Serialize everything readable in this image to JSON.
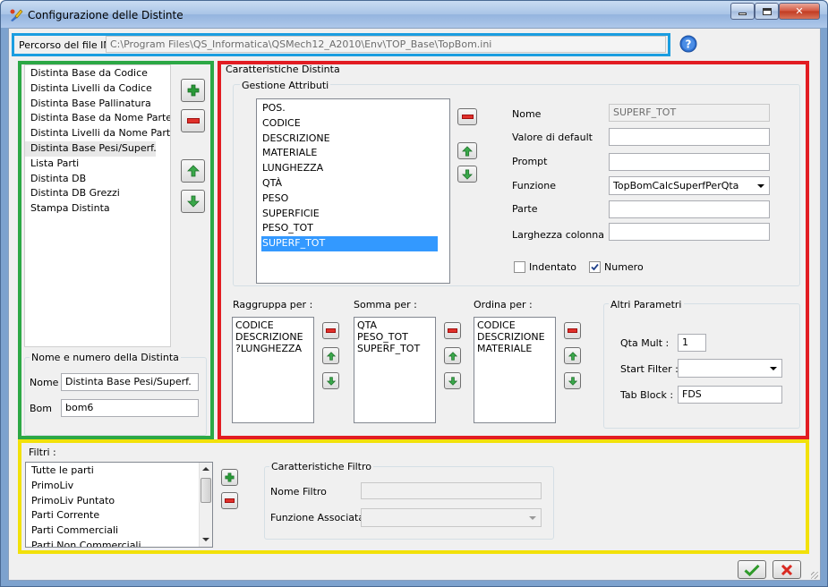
{
  "window": {
    "title": "Configurazione delle Distinte"
  },
  "ini": {
    "label": "Percorso del file INI",
    "path": "C:\\Program Files\\QS_Informatica\\QSMech12_A2010\\Env\\TOP_Base\\TopBom.ini"
  },
  "distinte": {
    "items": [
      "Distinta Base da Codice",
      "Distinta Livelli da Codice",
      "Distinta Base Pallinatura",
      "Distinta Base da Nome Parte",
      "Distinta Livelli da Nome Parte",
      "Distinta Base Pesi/Superf.",
      "Lista Parti",
      "Distinta DB",
      "Distinta DB Grezzi",
      "Stampa Distinta"
    ],
    "selected_index": 5,
    "group_title": "Nome e numero della Distinta",
    "nome_label": "Nome",
    "nome_value": "Distinta Base Pesi/Superf.",
    "bom_label": "Bom",
    "bom_value": "bom6"
  },
  "caratteristiche": {
    "title": "Caratteristiche Distinta",
    "gestione_title": "Gestione Attributi",
    "attributes": [
      "POS.",
      "CODICE",
      "DESCRIZIONE",
      "MATERIALE",
      "LUNGHEZZA",
      "QTÀ",
      "PESO",
      "SUPERFICIE",
      "PESO_TOT",
      "SUPERF_TOT"
    ],
    "selected_attribute_index": 9,
    "nome_label": "Nome",
    "nome_value": "SUPERF_TOT",
    "default_label": "Valore di default",
    "default_value": "",
    "prompt_label": "Prompt",
    "prompt_value": "",
    "funzione_label": "Funzione",
    "funzione_value": "TopBomCalcSuperfPerQta",
    "parte_label": "Parte",
    "parte_value": "",
    "larghezza_label": "Larghezza colonna",
    "larghezza_value": "",
    "indentato_label": "Indentato",
    "indentato_checked": false,
    "numero_label": "Numero",
    "numero_checked": true,
    "raggruppa_label": "Raggruppa per :",
    "raggruppa_text": "CODICE\nDESCRIZIONE\n?LUNGHEZZA",
    "somma_label": "Somma per :",
    "somma_text": "QTA\nPESO_TOT\nSUPERF_TOT",
    "ordina_label": "Ordina per :",
    "ordina_text": "CODICE\nDESCRIZIONE\nMATERIALE",
    "altri_title": "Altri Parametri",
    "qta_mult_label": "Qta Mult :",
    "qta_mult_value": "1",
    "start_filter_label": "Start Filter :",
    "start_filter_value": "",
    "tab_block_label": "Tab Block :",
    "tab_block_value": "FDS"
  },
  "filtri": {
    "label": "Filtri :",
    "items": [
      "Tutte le parti",
      "PrimoLiv",
      "PrimoLiv Puntato",
      "Parti Corrente",
      "Parti Commerciali",
      "Parti Non Commerciali"
    ],
    "group_title": "Caratteristiche Filtro",
    "nome_label": "Nome Filtro",
    "nome_value": "",
    "funzione_label": "Funzione Associata",
    "funzione_value": ""
  },
  "colors": {
    "green": "#2ca845",
    "red": "#e21c22",
    "yellow": "#f2e10a",
    "blue": "#1a9de0",
    "selection": "#3399ff"
  },
  "icons": [
    "app-icon",
    "help-icon",
    "add-icon",
    "remove-icon",
    "up-arrow-icon",
    "down-arrow-icon",
    "ok-check-icon",
    "cancel-x-icon"
  ]
}
